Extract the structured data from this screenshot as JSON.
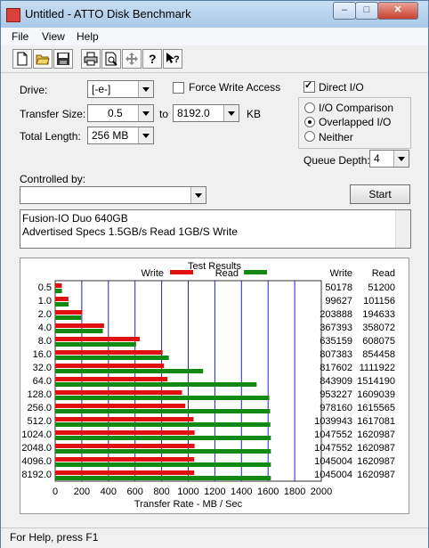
{
  "titlebar": {
    "title": "Untitled - ATTO Disk Benchmark",
    "buttons": {
      "minimize": "–",
      "maximize": "□",
      "close": "✕"
    }
  },
  "menu": [
    "File",
    "View",
    "Help"
  ],
  "toolbar": {
    "icons": [
      "new-icon",
      "open-icon",
      "save-icon",
      "print-icon",
      "print-preview-icon",
      "move-icon",
      "help-icon",
      "context-help-icon"
    ]
  },
  "form": {
    "drive_label": "Drive:",
    "drive_value": "[-e-]",
    "force_write_label": "Force Write Access",
    "force_write_checked": false,
    "direct_io_label": "Direct I/O",
    "direct_io_checked": true,
    "transfer_size_label": "Transfer Size:",
    "transfer_from": "0.5",
    "to_label": "to",
    "transfer_to": "8192.0",
    "kb_label": "KB",
    "total_length_label": "Total Length:",
    "total_length": "256 MB",
    "io_comparison": "I/O Comparison",
    "overlapped_io": "Overlapped I/O",
    "neither": "Neither",
    "selected_mode": "Overlapped I/O",
    "queue_depth_label": "Queue Depth:",
    "queue_depth": "4",
    "controlled_by_label": "Controlled by:",
    "controlled_by": "",
    "start_label": "Start",
    "description_line1": "Fusion-IO Duo 640GB",
    "description_line2": "Advertised Specs 1.5GB/s Read 1GB/S Write"
  },
  "chart_data": {
    "type": "bar",
    "title": "Test Results",
    "xlabel": "Transfer Rate - MB / Sec",
    "xlim": [
      0,
      2000
    ],
    "xticks": [
      0,
      200,
      400,
      600,
      800,
      1000,
      1200,
      1400,
      1600,
      1800,
      2000
    ],
    "legend": [
      "Write",
      "Read"
    ],
    "legend_placement": "top",
    "column_headers": [
      "Write",
      "Read"
    ],
    "colors": {
      "write": "#e01010",
      "read": "#128a12",
      "grid": "#2222cc"
    },
    "categories": [
      "0.5",
      "1.0",
      "2.0",
      "4.0",
      "8.0",
      "16.0",
      "32.0",
      "64.0",
      "128.0",
      "256.0",
      "512.0",
      "1024.0",
      "2048.0",
      "4096.0",
      "8192.0"
    ],
    "series": [
      {
        "name": "Write",
        "values": [
          50178,
          99627,
          203888,
          367393,
          635159,
          807383,
          817602,
          843909,
          953227,
          978160,
          1039943,
          1047552,
          1047552,
          1045004,
          1045004
        ]
      },
      {
        "name": "Read",
        "values": [
          51200,
          101156,
          194633,
          358072,
          608075,
          854458,
          1111922,
          1514190,
          1609039,
          1615565,
          1617081,
          1620987,
          1620987,
          1620987,
          1620987
        ]
      }
    ]
  },
  "statusbar": {
    "text": "For Help, press F1"
  }
}
